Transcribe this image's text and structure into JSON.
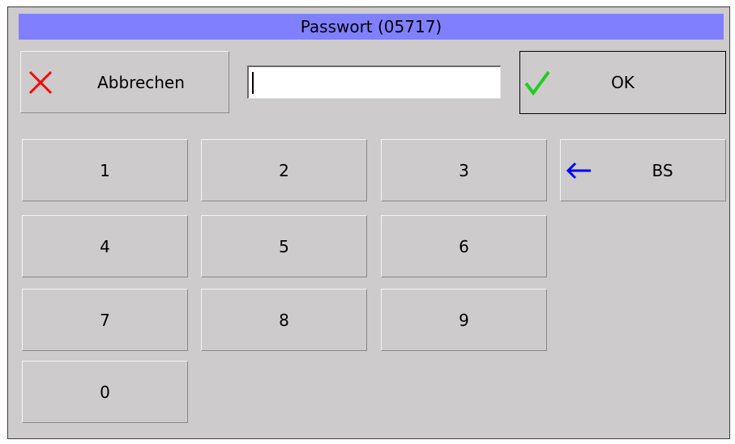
{
  "dialog": {
    "title": "Passwort (05717)"
  },
  "toolbar": {
    "cancel_label": "Abbrechen",
    "ok_label": "OK",
    "cancel_icon": "red-x-icon",
    "ok_icon": "green-checkmark-icon"
  },
  "password_field": {
    "value": ""
  },
  "keypad": {
    "keys": [
      "1",
      "2",
      "3",
      "4",
      "5",
      "6",
      "7",
      "8",
      "9",
      "0"
    ],
    "backspace_label": "BS",
    "backspace_icon": "blue-left-arrow-icon"
  },
  "colors": {
    "title_bar": "#8080ff",
    "dialog_bg": "#cdcbcb",
    "cancel_icon": "#ff0000",
    "ok_icon": "#22cc22",
    "backspace_icon": "#0000ff"
  }
}
